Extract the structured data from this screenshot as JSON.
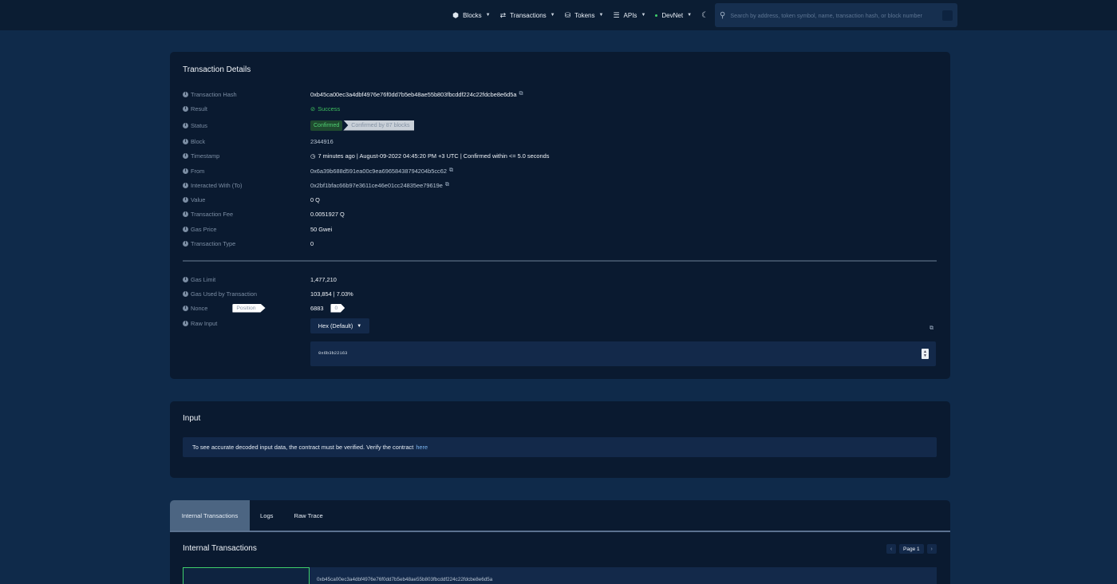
{
  "nav": {
    "items": [
      {
        "label": "Blocks",
        "icon": "cube-icon",
        "glyph": "⬢"
      },
      {
        "label": "Transactions",
        "icon": "transactions-icon",
        "glyph": "⇄"
      },
      {
        "label": "Tokens",
        "icon": "tokens-icon",
        "glyph": "⛁"
      },
      {
        "label": "APIs",
        "icon": "list-icon",
        "glyph": "☰"
      },
      {
        "label": "DevNet",
        "icon": "network-dot-icon",
        "glyph": ""
      }
    ],
    "theme_icon": "☾",
    "search_placeholder": "Search by address, token symbol, name, transaction hash, or block number"
  },
  "details": {
    "title": "Transaction Details",
    "rows": {
      "hash": {
        "label": "Transaction Hash",
        "value": "0xb45ca00ec3a4dbf4976e76f0dd7b5eb48ae55b803fbcddf224c22fdcbe8e6d5a"
      },
      "result": {
        "label": "Result",
        "value": "Success"
      },
      "status": {
        "label": "Status",
        "confirmed": "Confirmed",
        "blocks": "Confirmed by 87 blocks"
      },
      "block": {
        "label": "Block",
        "value": "2344916"
      },
      "timestamp": {
        "label": "Timestamp",
        "value": "7 minutes ago | August-09-2022 04:45:20 PM +3 UTC | Confirmed within <= 5.0 seconds"
      },
      "from": {
        "label": "From",
        "value": "0x6a39b688d591ea00c9ea69658438794204b5cc62"
      },
      "to": {
        "label": "Interacted With (To)",
        "value": "0x2bf1bfac66b97e3611ce46e01cc24835ee79619e"
      },
      "value": {
        "label": "Value",
        "value": "0 Q"
      },
      "fee": {
        "label": "Transaction Fee",
        "value": "0.0051927 Q"
      },
      "gas_price": {
        "label": "Gas Price",
        "value": "50 Gwei"
      },
      "tx_type": {
        "label": "Transaction Type",
        "value": "0"
      },
      "gas_limit": {
        "label": "Gas Limit",
        "value": "1,477,210"
      },
      "gas_used": {
        "label": "Gas Used by Transaction",
        "value": "103,854 | 7.03%"
      },
      "nonce": {
        "label": "Nonce",
        "position_label": "Position",
        "value": "6883",
        "position": "0"
      },
      "raw_input": {
        "label": "Raw Input",
        "format": "Hex (Default)",
        "data": "0x6b3b22163"
      }
    }
  },
  "input": {
    "title": "Input",
    "note": "To see accurate decoded input data, the contract must be verified. Verify the contract",
    "link": "here"
  },
  "tabs": {
    "items": [
      "Internal Transactions",
      "Logs",
      "Raw Trace"
    ],
    "section_title": "Internal Transactions",
    "page": "Page 1",
    "row_hash": "0xb45ca00ec3a4dbf4976e76f0dd7b5eb48ae55b803fbcddf224c22fdcbe8e6d5a"
  },
  "colors": {
    "background": "#0f2a4a",
    "card": "#0a1a30",
    "success": "#3fbf5e",
    "accent_link": "#7cb4ef"
  }
}
